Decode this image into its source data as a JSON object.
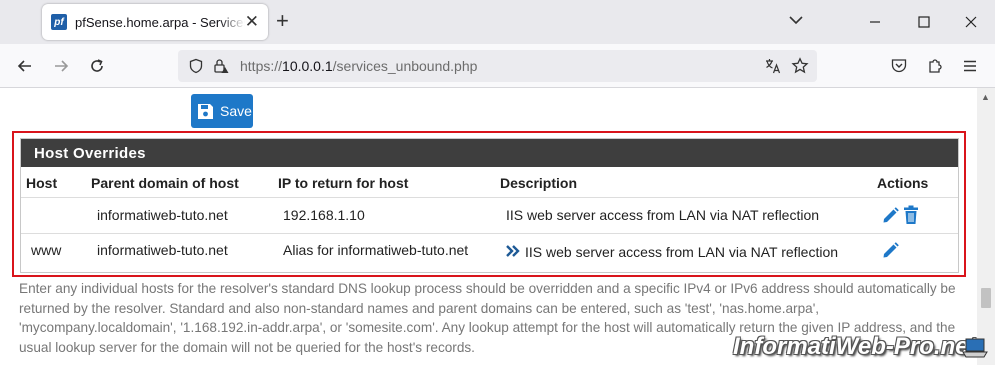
{
  "browser": {
    "tab_title": "pfSense.home.arpa - Services: DNS Resolver: General Settings",
    "tab_favicon_text": "pf",
    "url_prefix": "https://",
    "url_host": "10.0.0.1",
    "url_path": "/services_unbound.php"
  },
  "toolbar": {
    "save_label": "Save"
  },
  "panel": {
    "title": "Host Overrides",
    "columns": [
      "Host",
      "Parent domain of host",
      "IP to return for host",
      "Description",
      "Actions"
    ],
    "rows": [
      {
        "host": "",
        "domain": "informatiweb-tuto.net",
        "ip": "192.168.1.10",
        "description": "IIS web server access from LAN via NAT reflection"
      },
      {
        "host": "www",
        "domain": "informatiweb-tuto.net",
        "ip": "Alias for informatiweb-tuto.net",
        "description": "IIS web server access from LAN via NAT reflection"
      }
    ]
  },
  "help_text": "Enter any individual hosts for the resolver's standard DNS lookup process should be overridden and a specific IPv4 or IPv6 address should automatically be returned by the resolver. Standard and also non-standard names and parent domains can be entered, such as 'test', 'nas.home.arpa', 'mycompany.localdomain', '1.168.192.in-addr.arpa', or 'somesite.com'. Any lookup attempt for the host will automatically return the given IP address, and the usual lookup server for the domain will not be queried for the host's records.",
  "watermark": "InformatiWeb-Pro.net",
  "colors": {
    "save": "#1e78c8",
    "panel_header": "#3e3e3e",
    "highlight": "#d9141b",
    "action_icon": "#1e78c8"
  }
}
